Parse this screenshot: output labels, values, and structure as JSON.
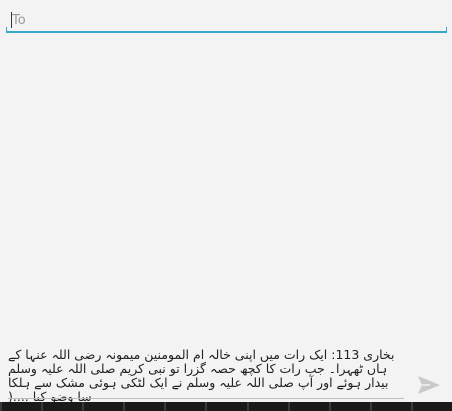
{
  "to_field": {
    "placeholder": "To",
    "value": ""
  },
  "compose": {
    "text": "بخاری 113: ایک رات میں اپنی خالہ ام المومنین میمونہ رضی اللہ عنہا کے ہاں ٹھہرا۔ جب رات کا کچھ حصہ گزرا تو نبی کریم صلی اللہ علیہ وسلم بیدار ہوئے اور آپ صلی اللہ علیہ وسلم نے ایک لٹکی ہوئی مشک سے ہلکا سا وضو کیا ....("
  },
  "icons": {
    "send": "send-icon"
  },
  "colors": {
    "accent": "#36a9c9",
    "background": "#f3f3f3",
    "send_icon": "#c9c9c9"
  }
}
